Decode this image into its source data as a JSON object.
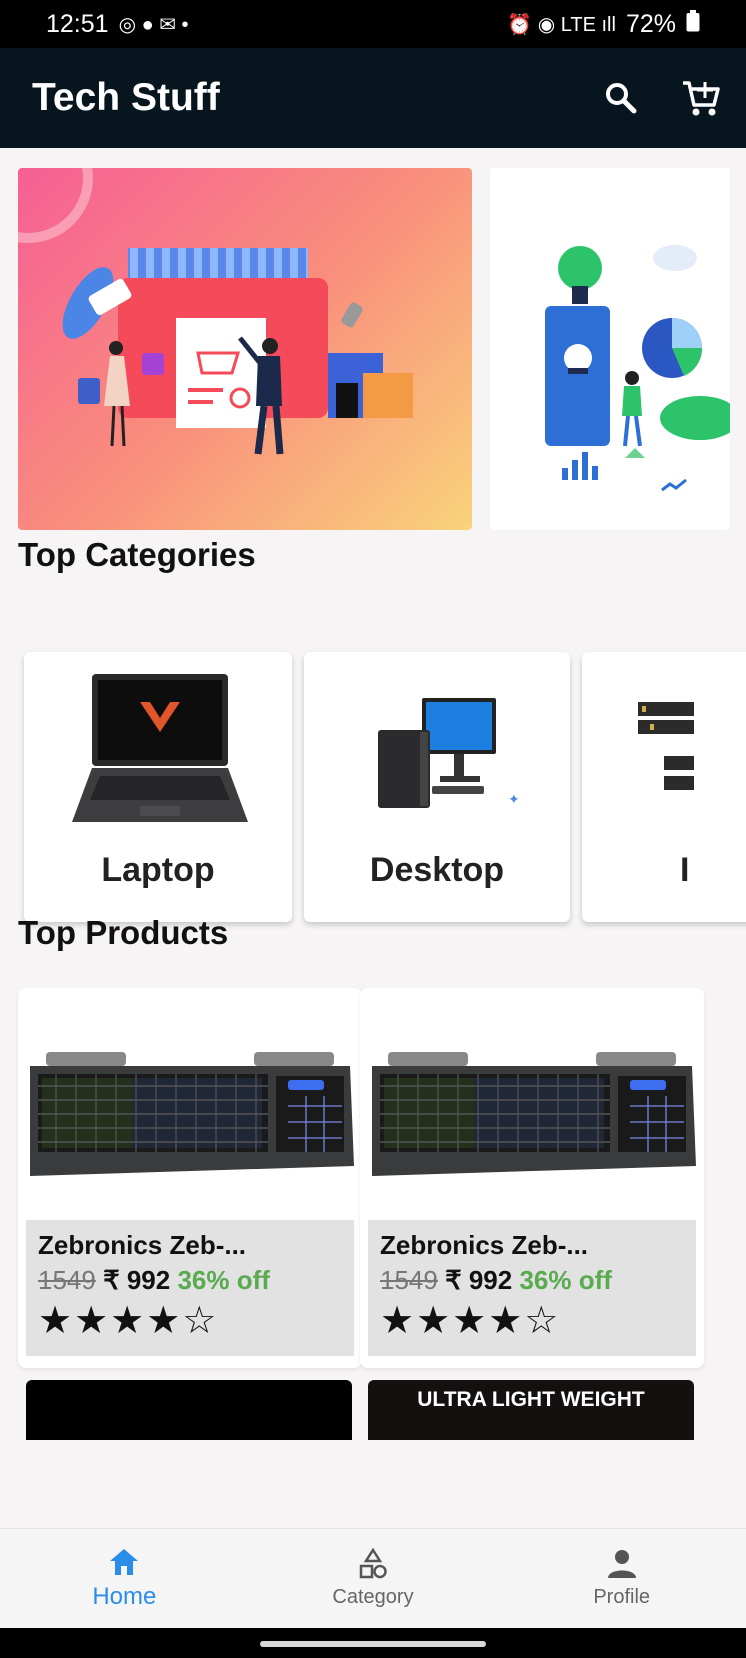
{
  "status_bar": {
    "time": "12:51",
    "left_glyphs": "◎ ● ✉ •",
    "right_glyphs": "⏰ ◉ LTE ıll",
    "battery": "72%"
  },
  "app_bar": {
    "title": "Tech Stuff",
    "search_icon": "search-icon",
    "cart_icon": "cart-icon"
  },
  "sections": {
    "categories_title": "Top Categories",
    "products_title": "Top Products"
  },
  "categories": [
    {
      "label": "Laptop"
    },
    {
      "label": "Desktop"
    },
    {
      "label": "I"
    }
  ],
  "products": [
    {
      "name": "Zebronics Zeb-...",
      "old_price": "1549",
      "price": "₹ 992",
      "discount": "36% off",
      "rating": 4,
      "stars": "★★★★☆"
    },
    {
      "name": "Zebronics Zeb-...",
      "old_price": "1549",
      "price": "₹ 992",
      "discount": "36% off",
      "rating": 4,
      "stars": "★★★★☆"
    }
  ],
  "next_products": {
    "second_banner_text": "ULTRA LIGHT WEIGHT"
  },
  "bottom_nav": [
    {
      "label": "Home",
      "icon": "home-icon",
      "active": true
    },
    {
      "label": "Category",
      "icon": "shapes-icon",
      "active": false
    },
    {
      "label": "Profile",
      "icon": "person-icon",
      "active": false
    }
  ],
  "colors": {
    "app_bar": "#07151e",
    "accent": "#2a8ee8",
    "discount": "#5aaa4f"
  }
}
